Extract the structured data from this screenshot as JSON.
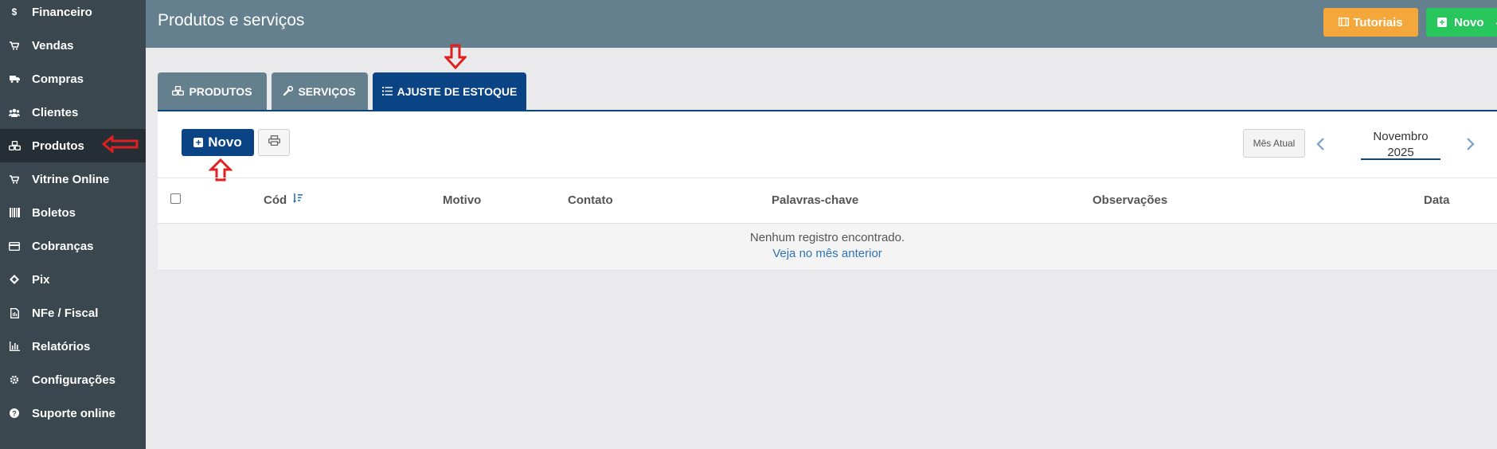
{
  "sidebar": {
    "items": [
      {
        "label": "Financeiro",
        "icon": "dollar-icon",
        "glyph": "$"
      },
      {
        "label": "Vendas",
        "icon": "cart-icon",
        "glyph": "🛒"
      },
      {
        "label": "Compras",
        "icon": "truck-icon",
        "glyph": "🚚"
      },
      {
        "label": "Clientes",
        "icon": "users-icon",
        "glyph": "👥"
      },
      {
        "label": "Produtos",
        "icon": "cubes-icon",
        "glyph": "⬢",
        "active": true
      },
      {
        "label": "Vitrine Online",
        "icon": "cart-icon",
        "glyph": "🛒"
      },
      {
        "label": "Boletos",
        "icon": "barcode-icon",
        "glyph": "▥"
      },
      {
        "label": "Cobranças",
        "icon": "credit-card-icon",
        "glyph": "▭"
      },
      {
        "label": "Pix",
        "icon": "pix-icon",
        "glyph": "◆"
      },
      {
        "label": "NFe / Fiscal",
        "icon": "document-icon",
        "glyph": "▤"
      },
      {
        "label": "Relatórios",
        "icon": "bar-chart-icon",
        "glyph": "▦"
      },
      {
        "label": "Configurações",
        "icon": "gear-icon",
        "glyph": "⚙"
      },
      {
        "label": "Suporte online",
        "icon": "question-icon",
        "glyph": "?"
      }
    ]
  },
  "header": {
    "title": "Produtos e serviços",
    "tutoriais_label": "Tutoriais",
    "novo_label": "Novo"
  },
  "tabs": [
    {
      "label": "PRODUTOS",
      "icon": "cubes-icon"
    },
    {
      "label": "SERVIÇOS",
      "icon": "wrench-icon"
    },
    {
      "label": "AJUSTE DE ESTOQUE",
      "icon": "list-icon",
      "active": true
    }
  ],
  "toolbar": {
    "novo_label": "Novo",
    "mes_atual_label": "Mês Atual",
    "month": "Novembro",
    "year": "2025"
  },
  "table": {
    "columns": [
      "Cód",
      "Motivo",
      "Contato",
      "Palavras-chave",
      "Observações",
      "Data"
    ],
    "empty_message": "Nenhum registro encontrado.",
    "empty_link": "Veja no mês anterior"
  },
  "colors": {
    "sidebar_bg": "#3a474f",
    "header_bg": "#647f8e",
    "primary": "#0b4485",
    "tutoriais": "#f4a83b",
    "novo_green": "#27c75e",
    "annotation_red": "#e02020"
  }
}
